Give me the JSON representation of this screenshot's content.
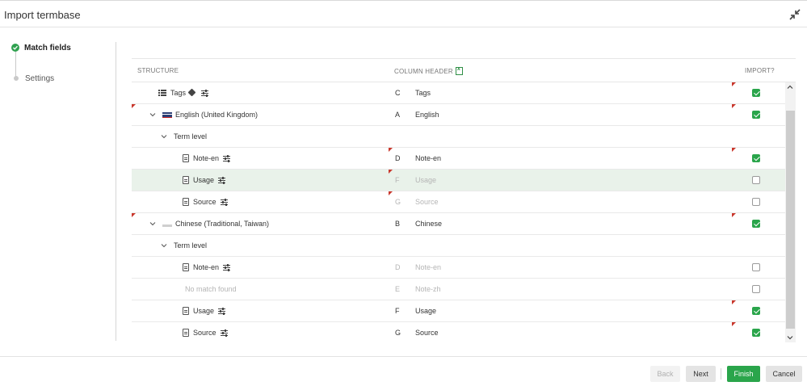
{
  "dialog": {
    "title": "Import termbase"
  },
  "steps": [
    {
      "label": "Match fields",
      "status": "done"
    },
    {
      "label": "Settings",
      "status": "pending"
    }
  ],
  "table": {
    "headers": {
      "structure": "STRUCTURE",
      "column_header": "COLUMN HEADER",
      "import": "IMPORT?"
    },
    "rows": [
      {
        "label": "Tags",
        "letter": "C",
        "header": "Tags",
        "checked": true,
        "muted": false
      },
      {
        "label": "English (United Kingdom)",
        "letter": "A",
        "header": "English",
        "checked": true,
        "muted": false
      },
      {
        "label": "Term level",
        "letter": "",
        "header": "",
        "checked": null,
        "muted": false
      },
      {
        "label": "Note-en",
        "letter": "D",
        "header": "Note-en",
        "checked": true,
        "muted": false
      },
      {
        "label": "Usage",
        "letter": "F",
        "header": "Usage",
        "checked": false,
        "muted": true
      },
      {
        "label": "Source",
        "letter": "G",
        "header": "Source",
        "checked": false,
        "muted": true
      },
      {
        "label": "Chinese (Traditional, Taiwan)",
        "letter": "B",
        "header": "Chinese",
        "checked": true,
        "muted": false
      },
      {
        "label": "Term level",
        "letter": "",
        "header": "",
        "checked": null,
        "muted": false
      },
      {
        "label": "Note-en",
        "letter": "D",
        "header": "Note-en",
        "checked": false,
        "muted": true
      },
      {
        "label": "No match found",
        "letter": "E",
        "header": "Note-zh",
        "checked": false,
        "muted": true
      },
      {
        "label": "Usage",
        "letter": "F",
        "header": "Usage",
        "checked": true,
        "muted": false
      },
      {
        "label": "Source",
        "letter": "G",
        "header": "Source",
        "checked": true,
        "muted": false
      }
    ]
  },
  "footer": {
    "back": "Back",
    "next": "Next",
    "finish": "Finish",
    "cancel": "Cancel"
  },
  "colors": {
    "accent": "#2aa54b",
    "marker": "#c9372c",
    "highlight": "#e9f2ea"
  },
  "icons": [
    "collapse-icon",
    "check-icon",
    "list-icon",
    "tag-icon",
    "sliders-icon",
    "document-icon",
    "flag-icon",
    "chevron-down-icon",
    "excel-icon"
  ]
}
